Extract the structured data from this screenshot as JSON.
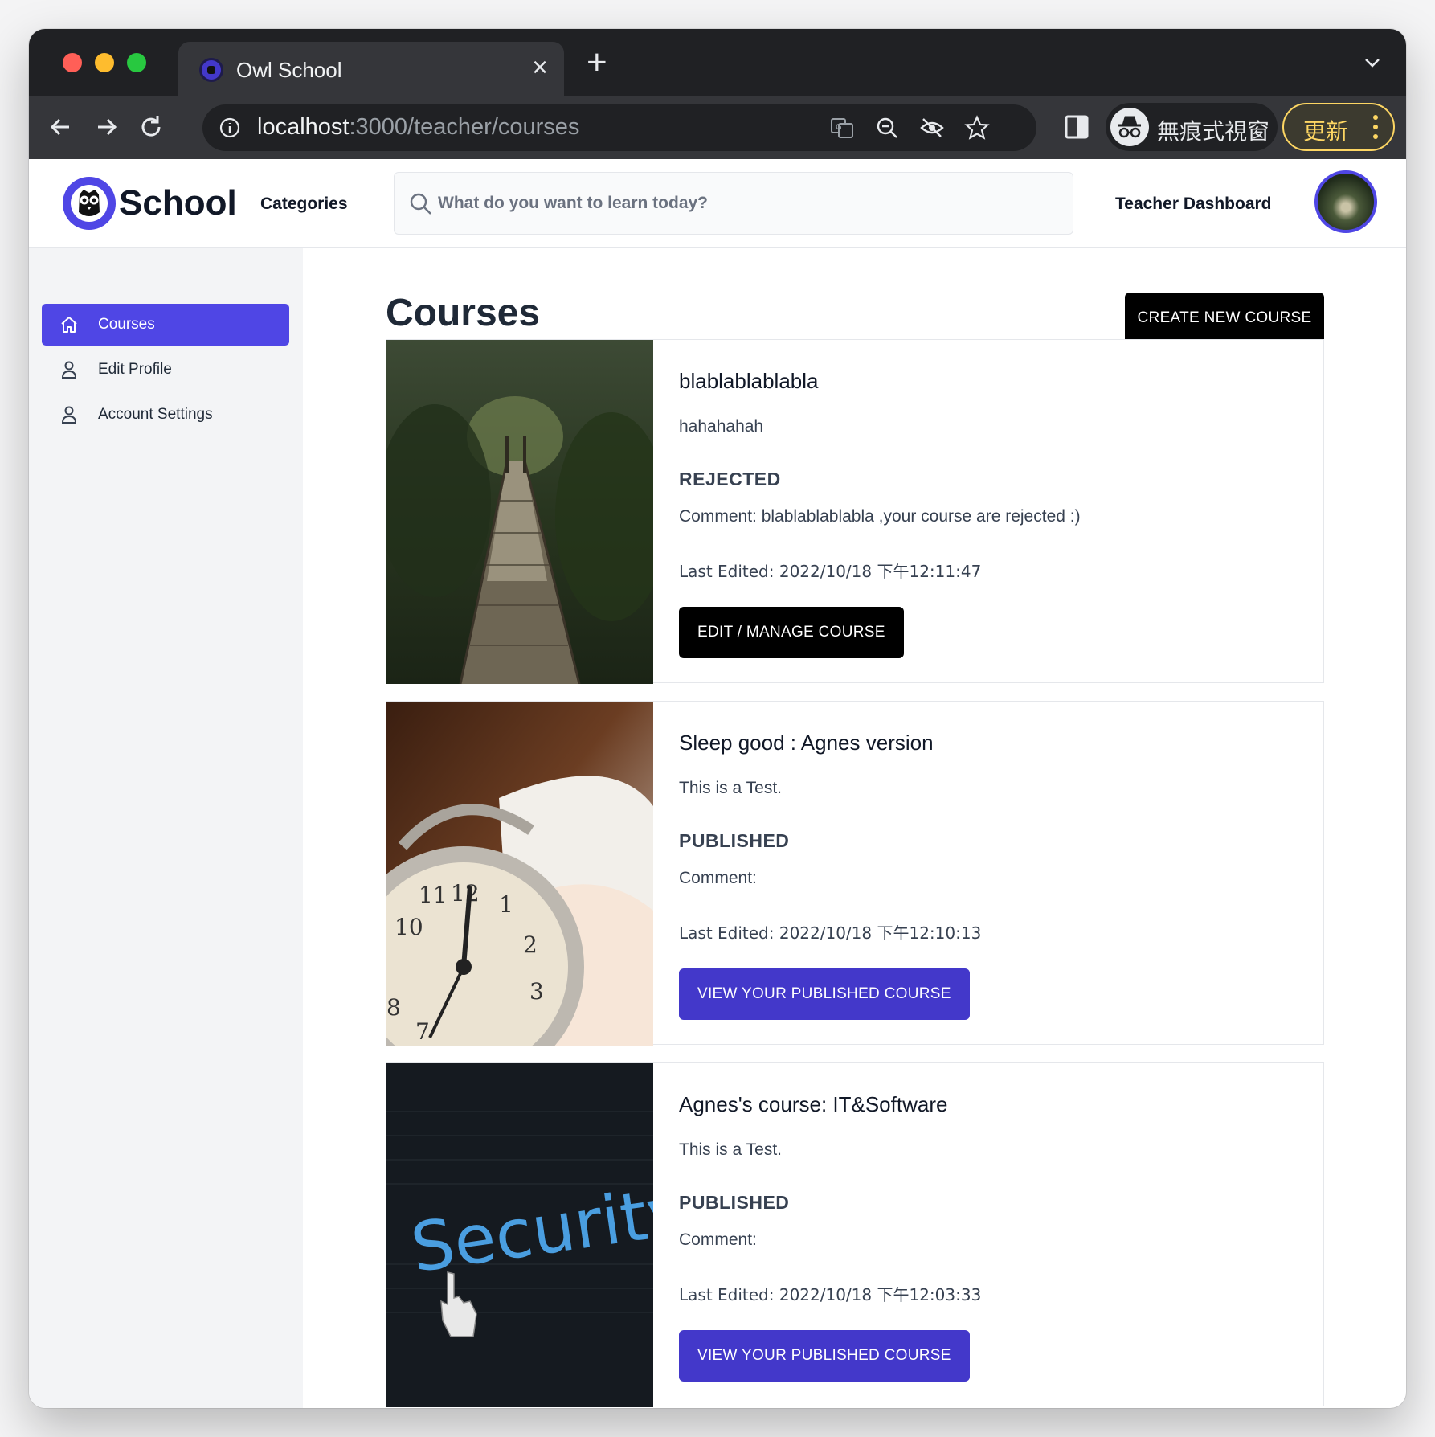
{
  "browser": {
    "tab_title": "Owl School",
    "url_host": "localhost",
    "url_path": ":3000/teacher/courses",
    "incognito_label": "無痕式視窗",
    "update_label": "更新"
  },
  "header": {
    "logo_text": "School",
    "categories": "Categories",
    "search_placeholder": "What do you want to learn today?",
    "teacher_dashboard": "Teacher Dashboard"
  },
  "sidebar": {
    "items": [
      {
        "label": "Courses",
        "icon": "home-icon",
        "active": true
      },
      {
        "label": "Edit Profile",
        "icon": "user-icon",
        "active": false
      },
      {
        "label": "Account Settings",
        "icon": "user-icon",
        "active": false
      }
    ]
  },
  "main": {
    "title": "Courses",
    "create_button": "CREATE NEW COURSE",
    "courses": [
      {
        "title": "blablablablabla",
        "description": "hahahahah",
        "status": "REJECTED",
        "comment": "Comment: blablablablabla ,your course are rejected :)",
        "last_edited": "Last Edited: 2022/10/18 下午12:11:47",
        "button": "EDIT / MANAGE COURSE",
        "image": "suspension-bridge-forest-photo"
      },
      {
        "title": "Sleep good : Agnes version",
        "description": "This is a Test.",
        "status": "PUBLISHED",
        "comment": "Comment:",
        "last_edited": "Last Edited: 2022/10/18 下午12:10:13",
        "button": "VIEW YOUR PUBLISHED COURSE",
        "image": "alarm-clock-photo"
      },
      {
        "title": "Agnes's course: IT&Software",
        "description": "This is a Test.",
        "status": "PUBLISHED",
        "comment": "Comment:",
        "last_edited": "Last Edited: 2022/10/18 下午12:03:33",
        "button": "VIEW YOUR PUBLISHED COURSE",
        "image": "security-screen-photo",
        "image_text": "Security"
      }
    ]
  },
  "colors": {
    "accent": "#4f46e5",
    "button_dark": "#000000",
    "button_indigo": "#4338ca"
  }
}
